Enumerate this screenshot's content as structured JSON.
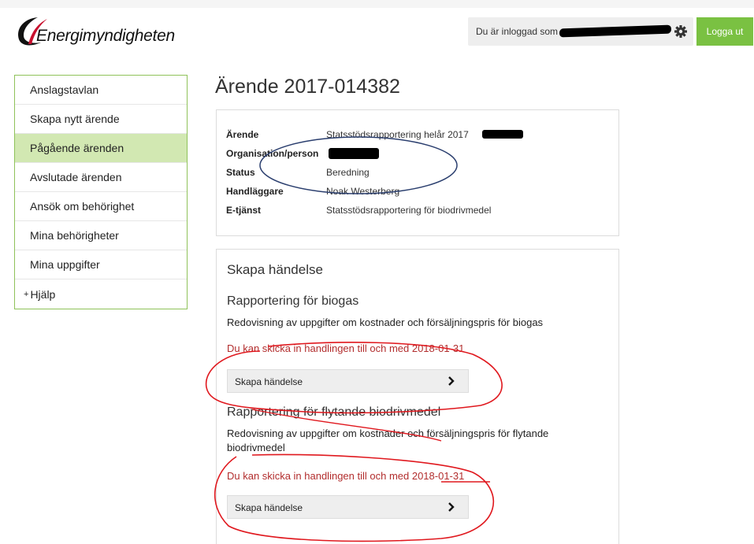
{
  "brand": {
    "name": "Energimyndigheten"
  },
  "header": {
    "logged_in_text": "Du är inloggad som",
    "logout_label": "Logga ut"
  },
  "sidebar": {
    "items": [
      {
        "label": "Anslagstavlan"
      },
      {
        "label": "Skapa nytt ärende"
      },
      {
        "label": "Pågående ärenden",
        "active": true
      },
      {
        "label": "Avslutade ärenden"
      },
      {
        "label": "Ansök om behörighet"
      },
      {
        "label": "Mina behörigheter"
      },
      {
        "label": "Mina uppgifter"
      },
      {
        "label": "Hjälp",
        "prefix": "+"
      }
    ]
  },
  "case": {
    "title": "Ärende 2017-014382",
    "rows": [
      {
        "key": "Ärende",
        "value": "Statsstödsrapportering helår 2017"
      },
      {
        "key": "Organisation/person",
        "value": ""
      },
      {
        "key": "Status",
        "value": "Beredning"
      },
      {
        "key": "Handläggare",
        "value": "Noak Westerberg"
      },
      {
        "key": "E-tjänst",
        "value": "Statsstödsrapportering för biodrivmedel"
      }
    ]
  },
  "events": {
    "heading": "Skapa händelse",
    "items": [
      {
        "title": "Rapportering för biogas",
        "description": "Redovisning av uppgifter om kostnader och försäljningspris för biogas",
        "deadline": "Du kan skicka in handlingen till och med 2018-01-31",
        "button": "Skapa händelse"
      },
      {
        "title": "Rapportering för flytande biodrivmedel",
        "description": "Redovisning av uppgifter om kostnader och försäljningspris för flytande biodrivmedel",
        "deadline": "Du kan skicka in handlingen till och med 2018-01-31",
        "button": "Skapa händelse"
      }
    ]
  },
  "colors": {
    "accent_green": "#7ac142",
    "sidebar_active": "#d2e8b2",
    "warning_red": "#b22d2d",
    "annotation_blue": "#2a3e6e",
    "annotation_red": "#e0181e"
  },
  "icons": {
    "logo": "swoosh-logo-icon",
    "settings": "gear-icon",
    "chevron": "chevron-right-icon"
  }
}
